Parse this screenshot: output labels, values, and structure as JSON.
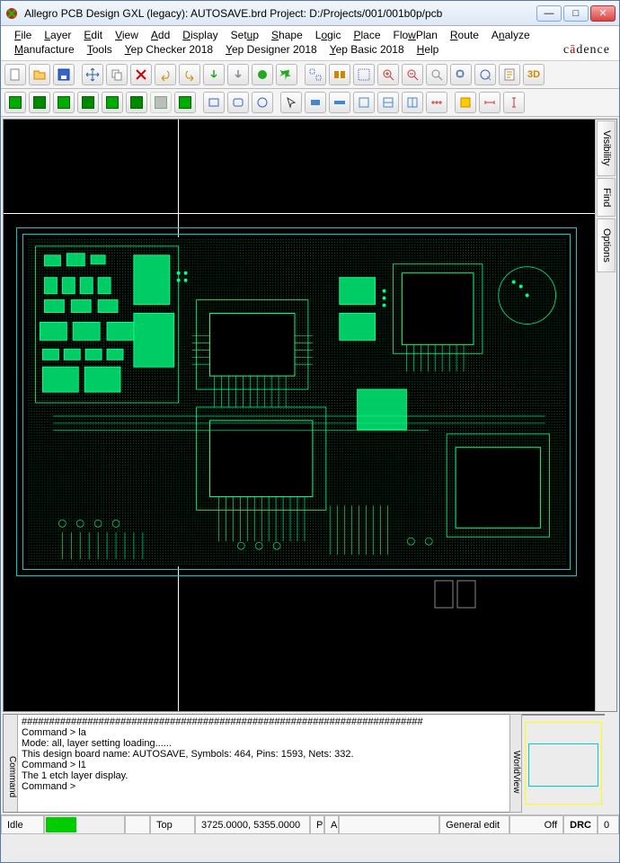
{
  "window": {
    "title": "Allegro PCB Design GXL (legacy): AUTOSAVE.brd  Project: D:/Projects/001/001b0p/pcb"
  },
  "menu": {
    "row1": [
      "File",
      "Layer",
      "Edit",
      "View",
      "Add",
      "Display",
      "Setup",
      "Shape",
      "Logic",
      "Place",
      "FlowPlan",
      "Route",
      "Analyze"
    ],
    "row2": [
      "Manufacture",
      "Tools",
      "Yep Checker 2018",
      "Yep Designer 2018",
      "Yep Basic 2018",
      "Help"
    ]
  },
  "brand": "cādence",
  "sidebar_tabs": [
    "Visibility",
    "Find",
    "Options"
  ],
  "console": {
    "tab": "Command",
    "lines": [
      "#########################################################################",
      "Command > la",
      "Mode: all, layer setting loading......",
      "This design board name: AUTOSAVE, Symbols: 464, Pins: 1593, Nets: 332.",
      "Command > l1",
      "The 1 etch layer display.",
      "Command >"
    ]
  },
  "worldview": {
    "tab": "WorldView"
  },
  "status": {
    "idle": "Idle",
    "layer": "Top",
    "coords": "3725.0000, 5355.0000",
    "p": "P",
    "a": "A",
    "mode": "General edit",
    "off": "Off",
    "drc": "DRC",
    "count": "0"
  },
  "toolbar1_icons": [
    "new",
    "open",
    "save",
    "sep",
    "move",
    "copy",
    "delete",
    "undo",
    "redo",
    "undo2",
    "redo2",
    "marker",
    "pin",
    "sep",
    "group",
    "flip",
    "ungroup",
    "zoom-in",
    "zoom-out",
    "zoom-fit",
    "zoom-sel",
    "zoom-world",
    "property",
    "3d"
  ],
  "toolbar2_icons": [
    "g1",
    "g2",
    "g3",
    "g4",
    "g5",
    "g6",
    "g7",
    "g8",
    "sep",
    "rect",
    "roundrect",
    "circle",
    "sep",
    "arrow",
    "shape1",
    "shape2",
    "shape3",
    "shape4",
    "shape5",
    "measure",
    "sep",
    "highlight",
    "dim-h",
    "dim-v"
  ]
}
